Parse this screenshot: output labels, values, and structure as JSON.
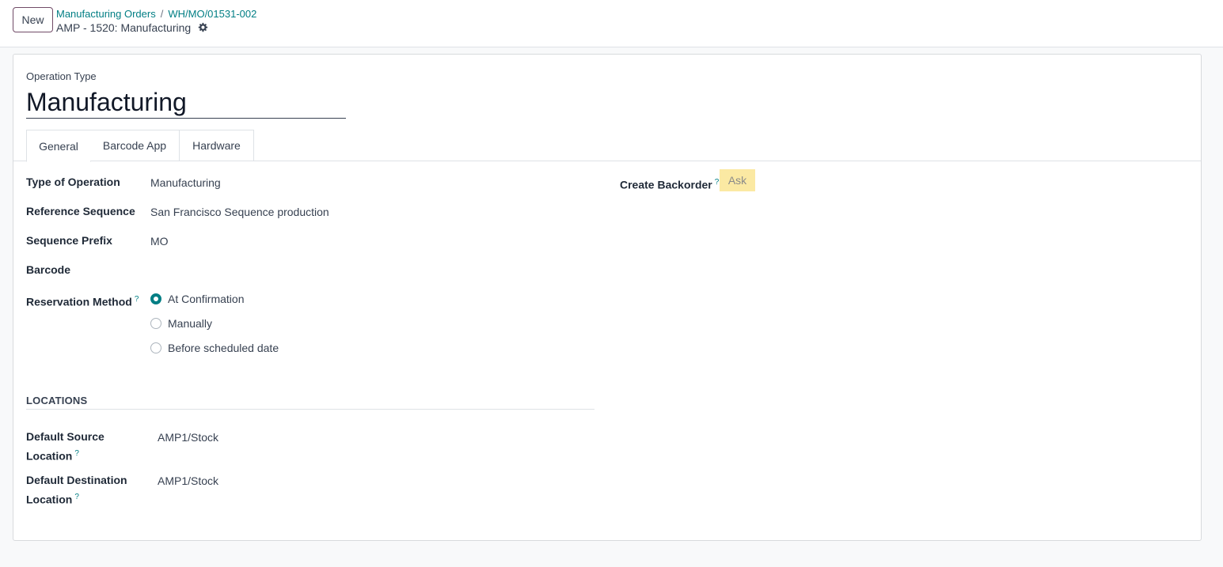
{
  "control_panel": {
    "new_label": "New",
    "breadcrumb": [
      "Manufacturing Orders",
      "WH/MO/01531-002"
    ],
    "separator": "/",
    "record_title": "AMP - 1520: Manufacturing"
  },
  "form": {
    "operation_type_label": "Operation Type",
    "name": "Manufacturing",
    "tabs": [
      {
        "label": "General",
        "active": true
      },
      {
        "label": "Barcode App",
        "active": false
      },
      {
        "label": "Hardware",
        "active": false
      }
    ],
    "fields": {
      "type_of_operation": {
        "label": "Type of Operation",
        "value": "Manufacturing"
      },
      "reference_sequence": {
        "label": "Reference Sequence",
        "value": "San Francisco Sequence production"
      },
      "sequence_prefix": {
        "label": "Sequence Prefix",
        "value": "MO"
      },
      "barcode": {
        "label": "Barcode",
        "value": ""
      },
      "reservation_method": {
        "label": "Reservation Method",
        "help": "?",
        "options": [
          {
            "label": "At Confirmation",
            "checked": true
          },
          {
            "label": "Manually",
            "checked": false
          },
          {
            "label": "Before scheduled date",
            "checked": false
          }
        ]
      },
      "create_backorder": {
        "label": "Create Backorder",
        "help": "?",
        "value": "Ask"
      }
    },
    "locations": {
      "title": "LOCATIONS",
      "default_source": {
        "label_line1": "Default Source",
        "label_line2": "Location",
        "help": "?",
        "value": "AMP1/Stock"
      },
      "default_destination": {
        "label_line1": "Default Destination",
        "label_line2": "Location",
        "help": "?",
        "value": "AMP1/Stock"
      }
    }
  },
  "colors": {
    "accent": "#017e84",
    "brand": "#714B67",
    "highlight": "#fbe9a3"
  }
}
